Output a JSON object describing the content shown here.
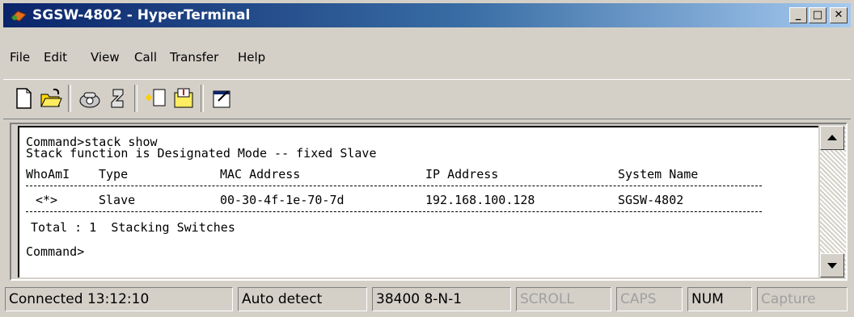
{
  "window": {
    "title": "SGSW-4802 - HyperTerminal"
  },
  "menu": [
    "File",
    "Edit",
    "View",
    "Call",
    "Transfer",
    "Help"
  ],
  "toolbar": [
    "new-icon",
    "open-icon",
    "connect-icon",
    "disconnect-icon",
    "send-icon",
    "receive-icon",
    "properties-icon"
  ],
  "terminal": {
    "line1": "Command>stack show",
    "line2": "Stack function is Designated Mode -- fixed Slave",
    "headers": {
      "who": "WhoAmI",
      "type": "Type",
      "mac": "MAC Address",
      "ip": "IP Address",
      "name": "System Name"
    },
    "row": {
      "who": "<*>",
      "type": "Slave",
      "mac": "00-30-4f-1e-70-7d",
      "ip": "192.168.100.128",
      "name": "SGSW-4802"
    },
    "total": "Total : 1  Stacking Switches",
    "prompt": "Command>"
  },
  "status": {
    "connected": "Connected 13:12:10",
    "detect": "Auto detect",
    "settings": "38400 8-N-1",
    "scroll": "SCROLL",
    "caps": "CAPS",
    "num": "NUM",
    "capture": "Capture"
  }
}
